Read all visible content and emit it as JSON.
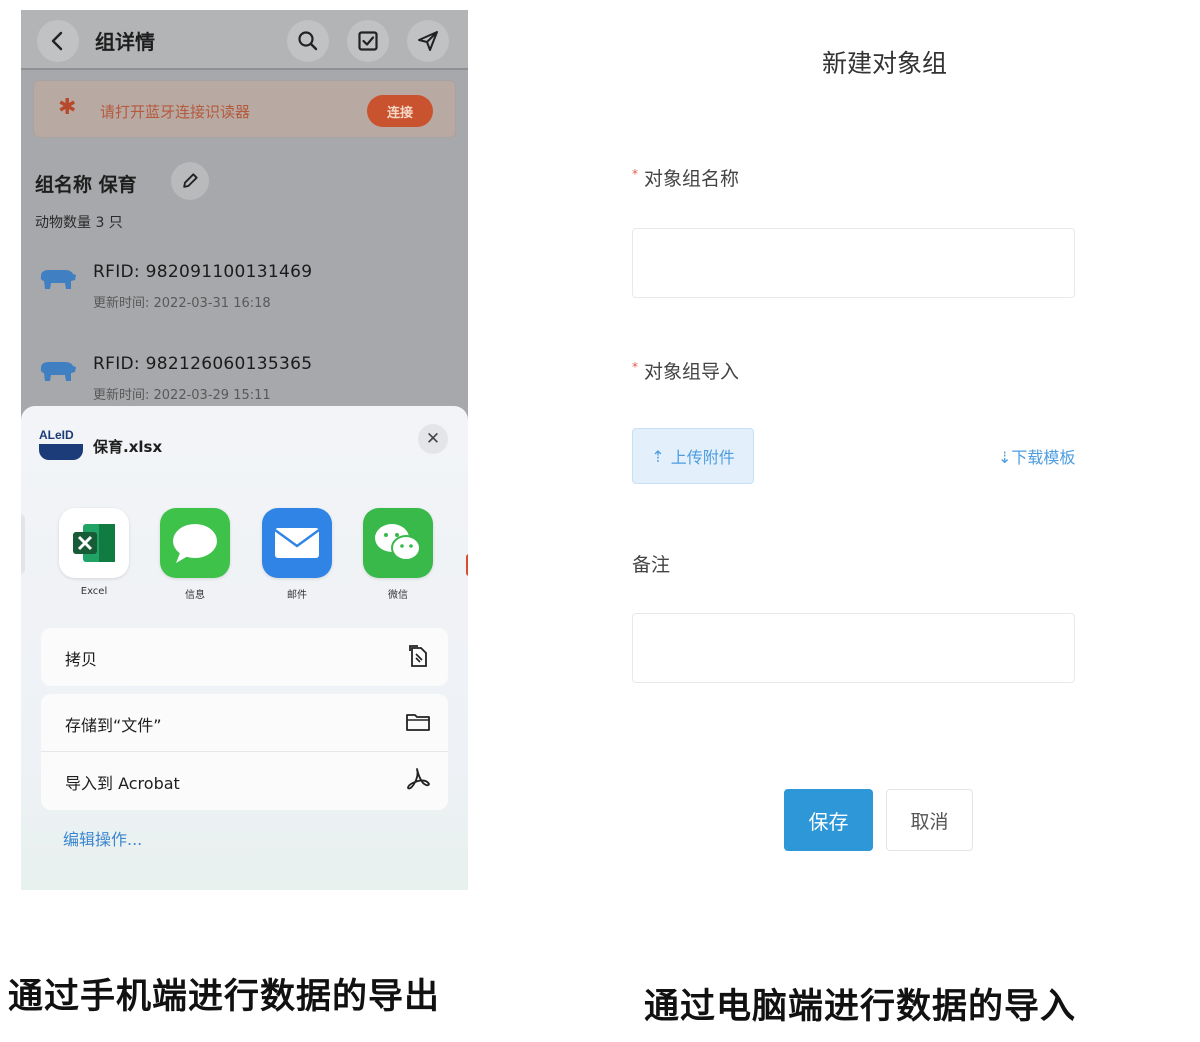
{
  "phone": {
    "nav": {
      "title": "组详情",
      "back_icon": "chevron-left-icon",
      "search_icon": "search-icon",
      "checkbox_icon": "checkbox-icon",
      "send_icon": "send-icon"
    },
    "bluetooth_banner": {
      "icon": "bluetooth-icon",
      "text": "请打开蓝牙连接识读器",
      "button": "连接"
    },
    "group": {
      "name": "组名称 保育",
      "count": "动物数量 3 只"
    },
    "animals": [
      {
        "rfid": "RFID: 982091100131469",
        "updated": "更新时间: 2022-03-31 16:18"
      },
      {
        "rfid": "RFID: 982126060135365",
        "updated": "更新时间: 2022-03-29 15:11"
      }
    ],
    "share_sheet": {
      "logo_text": "ALeID",
      "file_name": "保育.xlsx",
      "apps": [
        {
          "label": "Excel",
          "icon": "excel-icon",
          "color": "#1f7244"
        },
        {
          "label": "信息",
          "icon": "messages-icon",
          "color": "#3fc24a"
        },
        {
          "label": "邮件",
          "icon": "mail-icon",
          "color": "#2f84e6"
        },
        {
          "label": "微信",
          "icon": "wechat-icon",
          "color": "#38b94a"
        }
      ],
      "actions_group1": [
        {
          "label": "拷贝",
          "icon": "copy-icon"
        }
      ],
      "actions_group2": [
        {
          "label": "存储到“文件”",
          "icon": "folder-icon"
        },
        {
          "label": "导入到 Acrobat",
          "icon": "acrobat-icon"
        }
      ],
      "edit_actions": "编辑操作..."
    }
  },
  "form": {
    "title": "新建对象组",
    "name_label": "对象组名称",
    "import_label": "对象组导入",
    "upload_button": "上传附件",
    "download_link": "下载模板",
    "remark_label": "备注",
    "save_button": "保存",
    "cancel_button": "取消"
  },
  "captions": {
    "left": "通过手机端进行数据的导出",
    "right": "通过电脑端进行数据的导入"
  },
  "colors": {
    "primary_blue": "#2e97d8",
    "required_red": "#e05a4a",
    "bt_orange": "#c9532f"
  }
}
